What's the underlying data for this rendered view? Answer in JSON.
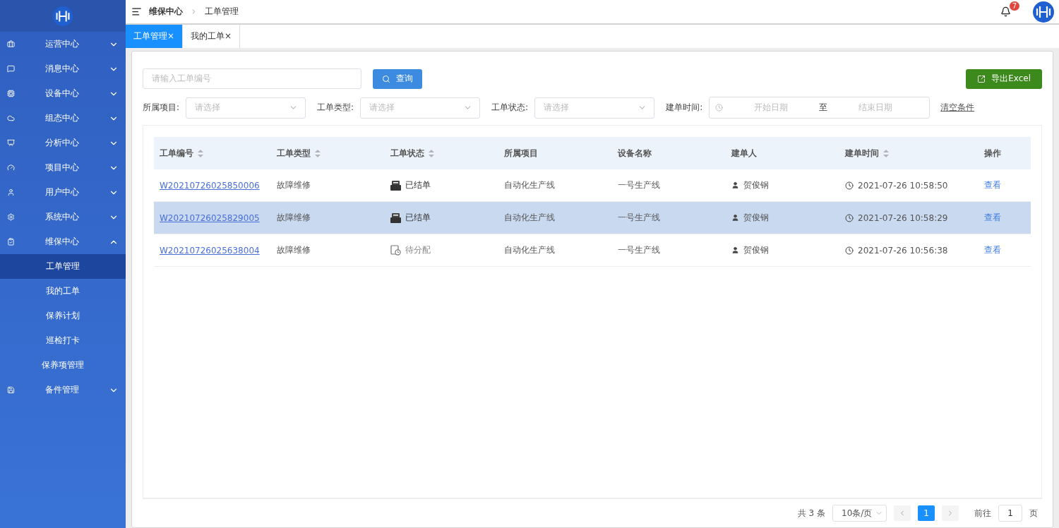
{
  "sidebar": {
    "items": [
      {
        "label": "运营中心",
        "expanded": false
      },
      {
        "label": "消息中心",
        "expanded": false
      },
      {
        "label": "设备中心",
        "expanded": false
      },
      {
        "label": "组态中心",
        "expanded": false
      },
      {
        "label": "分析中心",
        "expanded": false
      },
      {
        "label": "项目中心",
        "expanded": false
      },
      {
        "label": "用户中心",
        "expanded": false
      },
      {
        "label": "系统中心",
        "expanded": false
      },
      {
        "label": "维保中心",
        "expanded": true,
        "children": [
          {
            "label": "工单管理",
            "selected": true
          },
          {
            "label": "我的工单",
            "selected": false
          },
          {
            "label": "保养计划",
            "selected": false
          },
          {
            "label": "巡检打卡",
            "selected": false
          },
          {
            "label": "保养项管理",
            "selected": false
          }
        ]
      },
      {
        "label": "备件管理",
        "expanded": false
      }
    ]
  },
  "breadcrumb": [
    "维保中心",
    "工单管理"
  ],
  "notifications": {
    "count": "7"
  },
  "tabs": [
    {
      "label": "工单管理",
      "close": "×",
      "selected": true
    },
    {
      "label": "我的工单",
      "close": "×",
      "selected": false
    }
  ],
  "search": {
    "placeholder": "请输入工单编号",
    "button": "查询"
  },
  "export_button": "导出Excel",
  "filters": [
    {
      "label": "所属项目:",
      "placeholder": "请选择"
    },
    {
      "label": "工单类型:",
      "placeholder": "请选择"
    },
    {
      "label": "工单状态:",
      "placeholder": "请选择"
    }
  ],
  "date_range": {
    "label": "建单时间:",
    "start_placeholder": "开始日期",
    "separator": "至",
    "end_placeholder": "结束日期"
  },
  "clear_link": "清空条件",
  "table": {
    "columns": [
      {
        "label": "工单编号",
        "sortable": true
      },
      {
        "label": "工单类型",
        "sortable": true
      },
      {
        "label": "工单状态",
        "sortable": true
      },
      {
        "label": "所属项目",
        "sortable": false
      },
      {
        "label": "设备名称",
        "sortable": false
      },
      {
        "label": "建单人",
        "sortable": false
      },
      {
        "label": "建单时间",
        "sortable": true
      },
      {
        "label": "操作",
        "sortable": false
      }
    ],
    "rows": [
      {
        "id": "W20210726025850006",
        "type": "故障维修",
        "status": "已结单",
        "kind": "closed",
        "project": "自动化生产线",
        "device": "一号生产线",
        "creator": "贺俊钢",
        "time": "2021-07-26 10:58:50",
        "action": "查看",
        "selected": false
      },
      {
        "id": "W20210726025829005",
        "type": "故障维修",
        "status": "已结单",
        "kind": "closed",
        "project": "自动化生产线",
        "device": "一号生产线",
        "creator": "贺俊钢",
        "time": "2021-07-26 10:58:29",
        "action": "查看",
        "selected": true
      },
      {
        "id": "W20210726025638004",
        "type": "故障维修",
        "status": "待分配",
        "kind": "pending",
        "project": "自动化生产线",
        "device": "一号生产线",
        "creator": "贺俊钢",
        "time": "2021-07-26 10:56:38",
        "action": "查看",
        "selected": false
      }
    ]
  },
  "pagination": {
    "total": "共 3 条",
    "page_size": "10条/页",
    "pages": [
      {
        "label": "1",
        "selected": true
      }
    ],
    "goto_label": "前往",
    "goto_value": "1",
    "goto_suffix": "页"
  }
}
